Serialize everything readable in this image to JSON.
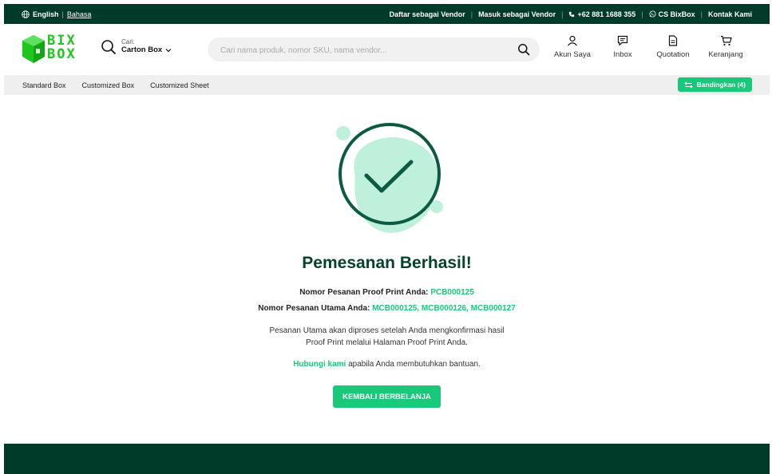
{
  "topbar": {
    "lang_english": "English",
    "lang_bahasa": "Bahasa",
    "links": [
      "Daftar sebagai Vendor",
      "Masuk sebagai Vendor",
      "+62 881 1688 355",
      "CS BixBox",
      "Kontak Kami"
    ]
  },
  "header": {
    "logo_line1": "BIX",
    "logo_line2": "BOX",
    "cari_label": "Cari:",
    "cari_value": "Carton Box",
    "search_placeholder": "Cari nama produk, nomor SKU, nama vendor...",
    "nav": [
      "Akun Saya",
      "Inbox",
      "Quotation",
      "Keranjang"
    ]
  },
  "categories": [
    "Standard Box",
    "Customized Box",
    "Customized Sheet"
  ],
  "compare_label": "Bandingkan (4)",
  "success": {
    "title": "Pemesanan Berhasil!",
    "proof_label": "Nomor Pesanan Proof Print Anda:",
    "proof_value": "PCB000125",
    "main_label": "Nomor Pesanan Utama Anda:",
    "main_value": "MCB000125, MCB000126, MCB000127",
    "message_line1": "Pesanan Utama akan diproses setelah Anda mengkonfirmasi hasil",
    "message_line2": "Proof Print melalui Halaman Proof Print Anda.",
    "contact_link": "Hubungi kami",
    "contact_rest": " apabila Anda membutuhkan bantuan.",
    "button": "KEMBALI BERBELANJA"
  },
  "colors": {
    "primary_dark": "#003a28",
    "accent_green": "#19c879",
    "title_green": "#06432d",
    "logo_green": "#1ec71e",
    "illustration_fill": "#bff0dc"
  },
  "icons": [
    "globe-icon",
    "phone-icon",
    "whatsapp-icon",
    "search-icon",
    "chevron-down-icon",
    "user-icon",
    "chat-icon",
    "document-icon",
    "cart-icon",
    "compare-icon",
    "check-circle-icon"
  ]
}
